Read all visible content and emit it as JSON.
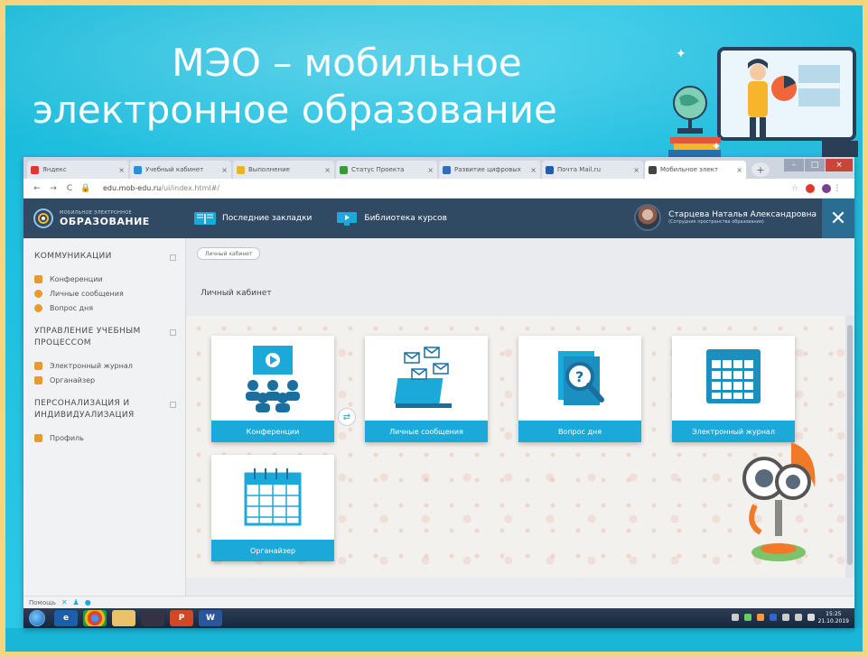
{
  "slide": {
    "title_line1": "МЭО – мобильное",
    "title_line2": "электронное образование"
  },
  "browser": {
    "tabs": [
      {
        "label": "Яндекс",
        "icon": "yandex-icon",
        "color": "#e0392b"
      },
      {
        "label": "Учебный кабинет",
        "icon": "page-icon",
        "color": "#2f8fd6"
      },
      {
        "label": "Выполнение",
        "icon": "star-icon",
        "color": "#e7b623"
      },
      {
        "label": "Статус Проекта",
        "icon": "check-icon",
        "color": "#3a9a3a"
      },
      {
        "label": "Развитие цифровых",
        "icon": "page-icon",
        "color": "#2f6fb8"
      },
      {
        "label": "Почта Mail.ru",
        "icon": "mail-icon",
        "color": "#1f5fa8"
      },
      {
        "label": "Мобильное элект",
        "icon": "meo-icon",
        "color": "#444444"
      }
    ],
    "url_host": "edu.mob-edu.ru",
    "url_path": "/ui/index.html#/"
  },
  "header": {
    "logo_small": "МОБИЛЬНОЕ ЭЛЕКТРОННОЕ",
    "logo_big": "ОБРАЗОВАНИЕ",
    "link_bookmarks": "Последние закладки",
    "link_library": "Библиотека курсов",
    "user_name": "Старцева Наталья Александровна",
    "user_role": "(Сотрудник пространства образования)"
  },
  "sidebar": {
    "sections": [
      {
        "title": "КОММУНИКАЦИИ",
        "items": [
          {
            "label": "Конференции",
            "color": "#e89a2c"
          },
          {
            "label": "Личные сообщения",
            "color": "#e89a2c"
          },
          {
            "label": "Вопрос дня",
            "color": "#e89a2c"
          }
        ]
      },
      {
        "title": "УПРАВЛЕНИЕ УЧЕБНЫМ ПРОЦЕССОМ",
        "items": [
          {
            "label": "Электронный журнал",
            "color": "#e89a2c"
          },
          {
            "label": "Органайзер",
            "color": "#e89a2c"
          }
        ]
      },
      {
        "title": "ПЕРСОНАЛИЗАЦИЯ И ИНДИВИДУАЛИЗАЦИЯ",
        "items": [
          {
            "label": "Профиль",
            "color": "#e89a2c"
          }
        ]
      }
    ]
  },
  "main": {
    "breadcrumb": "Личный кабинет",
    "page_title": "Личный кабинет",
    "tiles": [
      {
        "label": "Конференции",
        "icon": "conference-icon"
      },
      {
        "label": "Личные сообщения",
        "icon": "messages-icon"
      },
      {
        "label": "Вопрос дня",
        "icon": "question-icon"
      },
      {
        "label": "Электронный журнал",
        "icon": "journal-icon"
      },
      {
        "label": "Органайзер",
        "icon": "calendar-icon"
      }
    ]
  },
  "statusbar": {
    "help": "Помощь"
  },
  "taskbar": {
    "time": "15:25",
    "date": "21.10.2019"
  },
  "colors": {
    "accent": "#1ba9d9",
    "header": "#2f4a62",
    "slide_bg": "#17b9d9",
    "frame": "#f4d680"
  }
}
